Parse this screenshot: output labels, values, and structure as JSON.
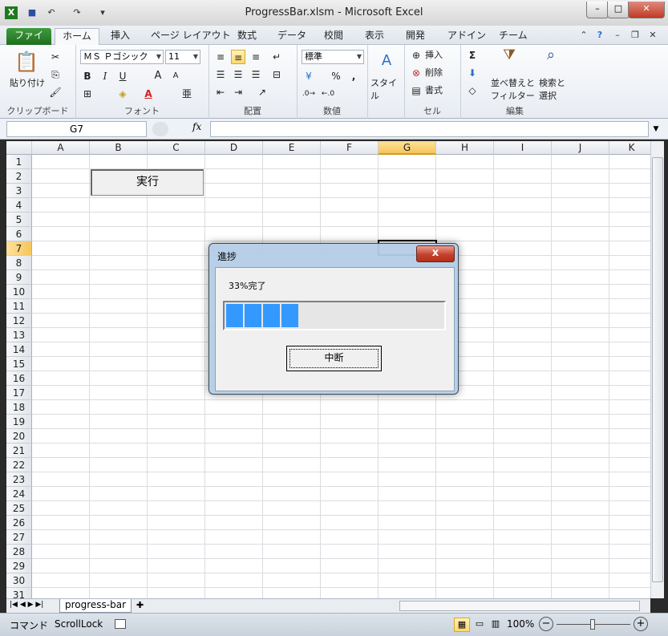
{
  "window": {
    "title": "ProgressBar.xlsm - Microsoft Excel"
  },
  "tabs": [
    "ファイル",
    "ホーム",
    "挿入",
    "ページ レイアウト",
    "数式",
    "データ",
    "校閲",
    "表示",
    "開発",
    "アドイン",
    "チーム"
  ],
  "ribbon": {
    "clipboard": {
      "label": "クリップボード",
      "paste": "貼り付け"
    },
    "font": {
      "label": "フォント",
      "name": "ＭＳ Ｐゴシック",
      "size": "11",
      "bold": "B",
      "italic": "I",
      "underline": "U",
      "grow": "A",
      "shrink": "A",
      "color_a": "A"
    },
    "alignment": {
      "label": "配置"
    },
    "number": {
      "label": "数値",
      "format": "標準",
      "percent": "%",
      "comma": ","
    },
    "styles": {
      "label": "スタイル"
    },
    "cells": {
      "label": "セル",
      "insert": "挿入",
      "delete": "削除",
      "format": "書式"
    },
    "editing": {
      "label": "編集",
      "sort_filter": [
        "並べ替えと",
        "フィルター"
      ],
      "find_select": [
        "検索と",
        "選択"
      ],
      "sigma": "Σ"
    }
  },
  "formula_bar": {
    "name_box": "G7",
    "fx": "fx",
    "value": ""
  },
  "sheet": {
    "columns": [
      "A",
      "B",
      "C",
      "D",
      "E",
      "F",
      "G",
      "H",
      "I",
      "J",
      "K"
    ],
    "rows": [
      "1",
      "2",
      "3",
      "4",
      "5",
      "6",
      "7",
      "8",
      "9",
      "10",
      "11",
      "12",
      "13",
      "14",
      "15",
      "16",
      "17",
      "18",
      "19",
      "20",
      "21",
      "22",
      "23",
      "24",
      "25",
      "26",
      "27",
      "28",
      "29",
      "30",
      "31"
    ],
    "active_col": "G",
    "active_row": "7",
    "run_button": "実行",
    "tab_name": "progress-bar"
  },
  "status": {
    "mode": "コマンド",
    "scroll_lock": "ScrollLock",
    "zoom": "100%"
  },
  "dialog": {
    "title": "進捗",
    "close": "x",
    "message": "33%完了",
    "progress_percent": 33,
    "cancel": "中断"
  },
  "colors": {
    "progress": "#3399ff",
    "file_tab": "#2a862a",
    "active_header": "#f4c65b"
  }
}
